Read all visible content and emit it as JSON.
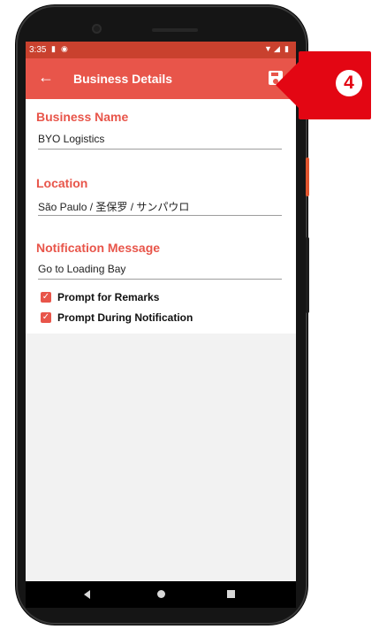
{
  "status_bar": {
    "time": "3:35",
    "left_icons": [
      "sd-card-icon",
      "sync-icon"
    ],
    "right_icons": [
      "wifi-icon",
      "signal-icon",
      "battery-icon"
    ]
  },
  "app_bar": {
    "title": "Business Details",
    "back_icon": "arrow-left-icon",
    "save_icon": "floppy-disk-icon",
    "color": "#e8554a"
  },
  "form": {
    "business_name": {
      "label": "Business Name",
      "value": "BYO Logistics"
    },
    "location": {
      "label": "Location",
      "value": "São Paulo / 圣保罗 / サンパウロ"
    },
    "notification_message": {
      "label": "Notification Message",
      "value": "Go to Loading Bay"
    },
    "prompt_remarks": {
      "label": "Prompt for Remarks",
      "checked": true
    },
    "prompt_notification": {
      "label": "Prompt During Notification",
      "checked": true
    }
  },
  "callout": {
    "number": "4",
    "color": "#e30613"
  },
  "nav_bar": {
    "icons": [
      "back-triangle-icon",
      "home-circle-icon",
      "recents-square-icon"
    ]
  }
}
